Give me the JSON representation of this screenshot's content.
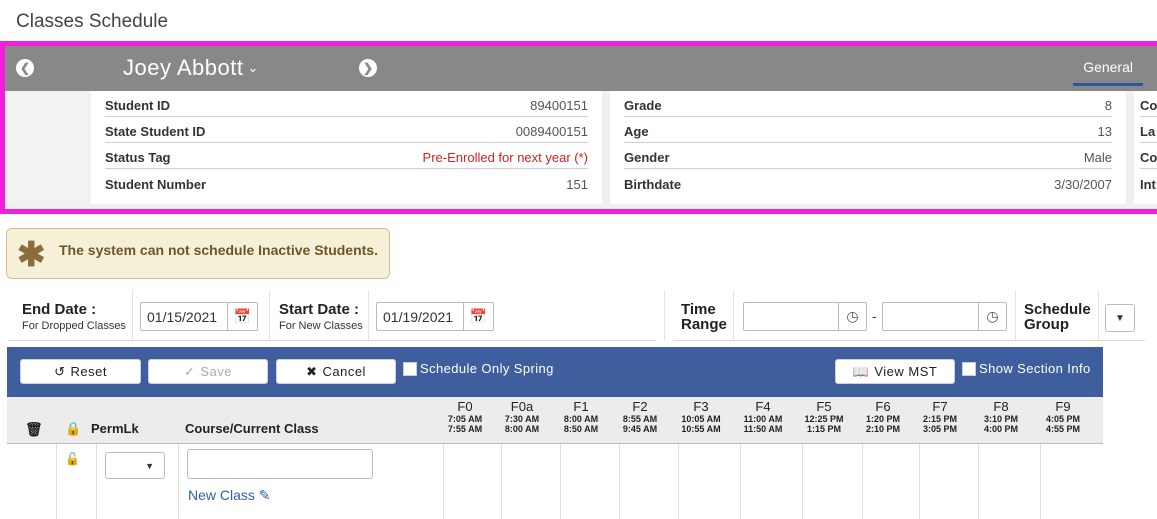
{
  "page_title": "Classes Schedule",
  "banner": {
    "student_name": "Joey Abbott",
    "tab_general": "General",
    "left_fields": [
      {
        "label": "Student ID",
        "value": "89400151"
      },
      {
        "label": "State Student ID",
        "value": "0089400151"
      },
      {
        "label": "Status Tag",
        "value": "Pre-Enrolled for next year (*)"
      },
      {
        "label": "Student Number",
        "value": "151"
      }
    ],
    "mid_fields": [
      {
        "label": "Grade",
        "value": "8"
      },
      {
        "label": "Age",
        "value": "13"
      },
      {
        "label": "Gender",
        "value": "Male"
      },
      {
        "label": "Birthdate",
        "value": "3/30/2007"
      }
    ],
    "right_fields": [
      {
        "label": "Co"
      },
      {
        "label": "La"
      },
      {
        "label": "Co"
      },
      {
        "label": "Int"
      }
    ],
    "status_color": "#d42020",
    "highlight_color": "#f01fdc"
  },
  "warning": {
    "message": "The system can not schedule Inactive Students."
  },
  "filters": {
    "end_date_label": "End Date :",
    "end_date_sub": "For Dropped Classes",
    "end_date_value": "01/15/2021",
    "start_date_label": "Start Date :",
    "start_date_sub": "For New Classes",
    "start_date_value": "01/19/2021",
    "time_range_label_1": "Time",
    "time_range_label_2": "Range",
    "time_sep": "-",
    "schedule_group_label_1": "Schedule",
    "schedule_group_label_2": "Group"
  },
  "toolbar": {
    "reset": "Reset",
    "save": "Save",
    "cancel": "Cancel",
    "schedule_only_spring": "Schedule Only Spring",
    "view_mst": "View MST",
    "show_section_info": "Show Section Info",
    "color": "#3e5e9d"
  },
  "grid": {
    "permlk": "PermLk",
    "course_label": "Course/Current Class",
    "periods": [
      {
        "name": "F0",
        "start": "7:05 AM",
        "end": "7:55 AM"
      },
      {
        "name": "F0a",
        "start": "7:30 AM",
        "end": "8:00 AM"
      },
      {
        "name": "F1",
        "start": "8:00 AM",
        "end": "8:50 AM"
      },
      {
        "name": "F2",
        "start": "8:55 AM",
        "end": "9:45 AM"
      },
      {
        "name": "F3",
        "start": "10:05 AM",
        "end": "10:55 AM"
      },
      {
        "name": "F4",
        "start": "11:00 AM",
        "end": "11:50 AM"
      },
      {
        "name": "F5",
        "start": "12:25 PM",
        "end": "1:15 PM"
      },
      {
        "name": "F6",
        "start": "1:20 PM",
        "end": "2:10 PM"
      },
      {
        "name": "F7",
        "start": "2:15 PM",
        "end": "3:05 PM"
      },
      {
        "name": "F8",
        "start": "3:10 PM",
        "end": "4:00 PM"
      },
      {
        "name": "F9",
        "start": "4:05 PM",
        "end": "4:55 PM"
      }
    ],
    "new_class": "New Class"
  }
}
